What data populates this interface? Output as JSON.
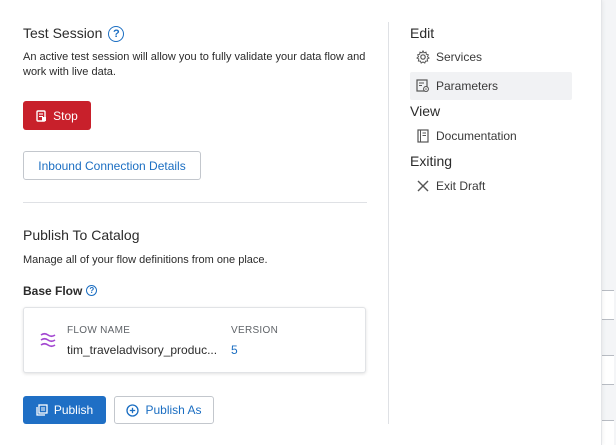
{
  "test_session": {
    "title": "Test Session",
    "help_glyph": "?",
    "description_line1": "An active test session will allow you to fully validate your data flow and",
    "description_line2": "work with live data.",
    "stop_label": "Stop",
    "inbound_label": "Inbound Connection Details"
  },
  "publish": {
    "title": "Publish To Catalog",
    "description": "Manage all of your flow definitions from one place.",
    "base_flow_label": "Base Flow",
    "help_glyph": "?",
    "flow_name_header": "FLOW NAME",
    "flow_name_value": "tim_traveladvisory_produc...",
    "version_header": "VERSION",
    "version_value": "5",
    "publish_label": "Publish",
    "publish_as_label": "Publish As"
  },
  "menu": {
    "edit_header": "Edit",
    "services_label": "Services",
    "parameters_label": "Parameters",
    "view_header": "View",
    "documentation_label": "Documentation",
    "exiting_header": "Exiting",
    "exit_draft_label": "Exit Draft"
  },
  "icons": {
    "help": "question-circle-icon",
    "stop": "stop-icon",
    "flow": "flow-waves-icon",
    "publish": "publish-icon",
    "publish_as": "add-circle-icon",
    "services": "gear-icon",
    "parameters": "parameters-icon",
    "documentation": "document-icon",
    "exit": "close-icon"
  },
  "colors": {
    "primary": "#1f6fc5",
    "danger": "#c8202b",
    "link": "#1b6ec2",
    "flow_icon": "#a347d1"
  }
}
